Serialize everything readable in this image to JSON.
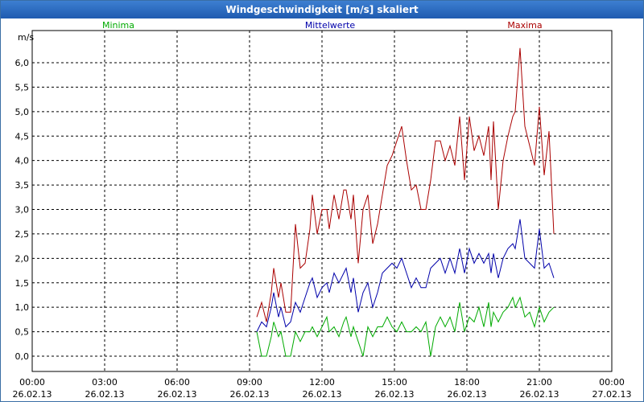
{
  "window": {
    "title": "Windgeschwindigkeit [m/s] skaliert"
  },
  "colors": {
    "minima": "#00aa00",
    "mittel": "#0000aa",
    "maxima": "#aa0000",
    "grid": "#000000"
  },
  "chart_data": {
    "type": "line",
    "title": "Windgeschwindigkeit [m/s] skaliert",
    "ylabel": "m/s",
    "ylim": [
      0.0,
      6.0
    ],
    "yticks": [
      0.0,
      0.5,
      1.0,
      1.5,
      2.0,
      2.5,
      3.0,
      3.5,
      4.0,
      4.5,
      5.0,
      5.5,
      6.0
    ],
    "ytick_labels": [
      "0,0",
      "0,5",
      "1,0",
      "1,5",
      "2,0",
      "2,5",
      "3,0",
      "3,5",
      "4,0",
      "4,5",
      "5,0",
      "5,5",
      "6,0"
    ],
    "xlim": [
      0,
      24
    ],
    "x_ticks": [
      {
        "time": "00:00",
        "date": "26.02.13",
        "x": 0
      },
      {
        "time": "03:00",
        "date": "26.02.13",
        "x": 3
      },
      {
        "time": "06:00",
        "date": "26.02.13",
        "x": 6
      },
      {
        "time": "09:00",
        "date": "26.02.13",
        "x": 9
      },
      {
        "time": "12:00",
        "date": "26.02.13",
        "x": 12
      },
      {
        "time": "15:00",
        "date": "26.02.13",
        "x": 15
      },
      {
        "time": "18:00",
        "date": "26.02.13",
        "x": 18
      },
      {
        "time": "21:00",
        "date": "26.02.13",
        "x": 21
      },
      {
        "time": "00:00",
        "date": "27.02.13",
        "x": 24
      }
    ],
    "grid": true,
    "legend": [
      "Minima",
      "Mittelwerte",
      "Maxima"
    ],
    "series": [
      {
        "name": "Maxima",
        "points": [
          [
            9.3,
            0.8
          ],
          [
            9.5,
            1.1
          ],
          [
            9.7,
            0.7
          ],
          [
            9.9,
            1.3
          ],
          [
            10.0,
            1.8
          ],
          [
            10.2,
            1.2
          ],
          [
            10.3,
            1.5
          ],
          [
            10.5,
            0.9
          ],
          [
            10.7,
            0.9
          ],
          [
            10.9,
            2.7
          ],
          [
            11.1,
            1.8
          ],
          [
            11.3,
            1.9
          ],
          [
            11.5,
            2.6
          ],
          [
            11.6,
            3.3
          ],
          [
            11.8,
            2.5
          ],
          [
            12.0,
            3.0
          ],
          [
            12.2,
            3.0
          ],
          [
            12.3,
            2.6
          ],
          [
            12.5,
            3.3
          ],
          [
            12.7,
            2.8
          ],
          [
            12.9,
            3.4
          ],
          [
            13.0,
            3.4
          ],
          [
            13.2,
            2.8
          ],
          [
            13.3,
            3.3
          ],
          [
            13.5,
            1.9
          ],
          [
            13.7,
            3.0
          ],
          [
            13.9,
            3.3
          ],
          [
            14.1,
            2.3
          ],
          [
            14.3,
            2.7
          ],
          [
            14.5,
            3.3
          ],
          [
            14.7,
            3.9
          ],
          [
            14.9,
            4.1
          ],
          [
            15.1,
            4.4
          ],
          [
            15.3,
            4.7
          ],
          [
            15.5,
            4.0
          ],
          [
            15.7,
            3.4
          ],
          [
            15.9,
            3.5
          ],
          [
            16.1,
            3.0
          ],
          [
            16.3,
            3.0
          ],
          [
            16.5,
            3.6
          ],
          [
            16.7,
            4.4
          ],
          [
            16.9,
            4.4
          ],
          [
            17.1,
            4.0
          ],
          [
            17.3,
            4.3
          ],
          [
            17.5,
            3.9
          ],
          [
            17.7,
            4.9
          ],
          [
            17.9,
            3.6
          ],
          [
            18.1,
            4.9
          ],
          [
            18.3,
            4.2
          ],
          [
            18.5,
            4.5
          ],
          [
            18.7,
            4.1
          ],
          [
            18.9,
            4.7
          ],
          [
            19.0,
            3.6
          ],
          [
            19.1,
            4.8
          ],
          [
            19.3,
            3.0
          ],
          [
            19.5,
            4.0
          ],
          [
            19.7,
            4.5
          ],
          [
            19.9,
            4.9
          ],
          [
            20.0,
            5.0
          ],
          [
            20.2,
            6.3
          ],
          [
            20.4,
            4.7
          ],
          [
            20.6,
            4.3
          ],
          [
            20.8,
            3.9
          ],
          [
            21.0,
            5.1
          ],
          [
            21.2,
            3.7
          ],
          [
            21.4,
            4.6
          ],
          [
            21.6,
            2.5
          ]
        ]
      },
      {
        "name": "Mittelwerte",
        "points": [
          [
            9.3,
            0.5
          ],
          [
            9.5,
            0.7
          ],
          [
            9.7,
            0.6
          ],
          [
            9.9,
            1.0
          ],
          [
            10.0,
            1.3
          ],
          [
            10.2,
            0.8
          ],
          [
            10.3,
            1.0
          ],
          [
            10.5,
            0.6
          ],
          [
            10.7,
            0.7
          ],
          [
            10.9,
            1.1
          ],
          [
            11.1,
            0.9
          ],
          [
            11.3,
            1.2
          ],
          [
            11.5,
            1.5
          ],
          [
            11.6,
            1.6
          ],
          [
            11.8,
            1.2
          ],
          [
            12.0,
            1.4
          ],
          [
            12.2,
            1.5
          ],
          [
            12.3,
            1.3
          ],
          [
            12.5,
            1.7
          ],
          [
            12.7,
            1.5
          ],
          [
            12.9,
            1.7
          ],
          [
            13.0,
            1.8
          ],
          [
            13.2,
            1.3
          ],
          [
            13.3,
            1.6
          ],
          [
            13.5,
            0.9
          ],
          [
            13.7,
            1.3
          ],
          [
            13.9,
            1.5
          ],
          [
            14.1,
            1.0
          ],
          [
            14.3,
            1.3
          ],
          [
            14.5,
            1.7
          ],
          [
            14.7,
            1.8
          ],
          [
            14.9,
            1.9
          ],
          [
            15.1,
            1.8
          ],
          [
            15.3,
            2.0
          ],
          [
            15.5,
            1.7
          ],
          [
            15.7,
            1.4
          ],
          [
            15.9,
            1.6
          ],
          [
            16.1,
            1.4
          ],
          [
            16.3,
            1.4
          ],
          [
            16.5,
            1.8
          ],
          [
            16.7,
            1.9
          ],
          [
            16.9,
            2.0
          ],
          [
            17.1,
            1.7
          ],
          [
            17.3,
            2.0
          ],
          [
            17.5,
            1.7
          ],
          [
            17.7,
            2.2
          ],
          [
            17.9,
            1.7
          ],
          [
            18.1,
            2.2
          ],
          [
            18.3,
            1.9
          ],
          [
            18.5,
            2.1
          ],
          [
            18.7,
            1.9
          ],
          [
            18.9,
            2.1
          ],
          [
            19.0,
            1.7
          ],
          [
            19.1,
            2.1
          ],
          [
            19.3,
            1.6
          ],
          [
            19.5,
            2.0
          ],
          [
            19.7,
            2.2
          ],
          [
            19.9,
            2.3
          ],
          [
            20.0,
            2.2
          ],
          [
            20.2,
            2.8
          ],
          [
            20.4,
            2.0
          ],
          [
            20.6,
            1.9
          ],
          [
            20.8,
            1.8
          ],
          [
            21.0,
            2.6
          ],
          [
            21.2,
            1.8
          ],
          [
            21.4,
            1.9
          ],
          [
            21.6,
            1.6
          ]
        ]
      },
      {
        "name": "Minima",
        "points": [
          [
            9.3,
            0.5
          ],
          [
            9.5,
            0.0
          ],
          [
            9.7,
            0.0
          ],
          [
            9.9,
            0.4
          ],
          [
            10.0,
            0.7
          ],
          [
            10.2,
            0.4
          ],
          [
            10.3,
            0.5
          ],
          [
            10.5,
            0.0
          ],
          [
            10.7,
            0.0
          ],
          [
            10.9,
            0.5
          ],
          [
            11.1,
            0.3
          ],
          [
            11.3,
            0.5
          ],
          [
            11.5,
            0.5
          ],
          [
            11.6,
            0.6
          ],
          [
            11.8,
            0.4
          ],
          [
            12.0,
            0.6
          ],
          [
            12.2,
            0.8
          ],
          [
            12.3,
            0.5
          ],
          [
            12.5,
            0.6
          ],
          [
            12.7,
            0.4
          ],
          [
            12.9,
            0.7
          ],
          [
            13.0,
            0.8
          ],
          [
            13.2,
            0.4
          ],
          [
            13.3,
            0.6
          ],
          [
            13.5,
            0.3
          ],
          [
            13.7,
            0.0
          ],
          [
            13.9,
            0.6
          ],
          [
            14.1,
            0.4
          ],
          [
            14.3,
            0.6
          ],
          [
            14.5,
            0.6
          ],
          [
            14.7,
            0.8
          ],
          [
            14.9,
            0.6
          ],
          [
            15.1,
            0.5
          ],
          [
            15.3,
            0.7
          ],
          [
            15.5,
            0.5
          ],
          [
            15.7,
            0.5
          ],
          [
            15.9,
            0.6
          ],
          [
            16.1,
            0.5
          ],
          [
            16.3,
            0.7
          ],
          [
            16.5,
            0.0
          ],
          [
            16.7,
            0.6
          ],
          [
            16.9,
            0.8
          ],
          [
            17.1,
            0.6
          ],
          [
            17.3,
            0.8
          ],
          [
            17.5,
            0.5
          ],
          [
            17.7,
            1.1
          ],
          [
            17.9,
            0.5
          ],
          [
            18.1,
            0.8
          ],
          [
            18.3,
            0.7
          ],
          [
            18.5,
            1.0
          ],
          [
            18.7,
            0.6
          ],
          [
            18.9,
            1.1
          ],
          [
            19.0,
            0.6
          ],
          [
            19.1,
            0.9
          ],
          [
            19.3,
            0.7
          ],
          [
            19.5,
            0.9
          ],
          [
            19.7,
            1.0
          ],
          [
            19.9,
            1.2
          ],
          [
            20.0,
            1.0
          ],
          [
            20.2,
            1.2
          ],
          [
            20.4,
            0.8
          ],
          [
            20.6,
            0.9
          ],
          [
            20.8,
            0.6
          ],
          [
            21.0,
            1.0
          ],
          [
            21.2,
            0.7
          ],
          [
            21.4,
            0.9
          ],
          [
            21.6,
            1.0
          ]
        ]
      }
    ]
  }
}
